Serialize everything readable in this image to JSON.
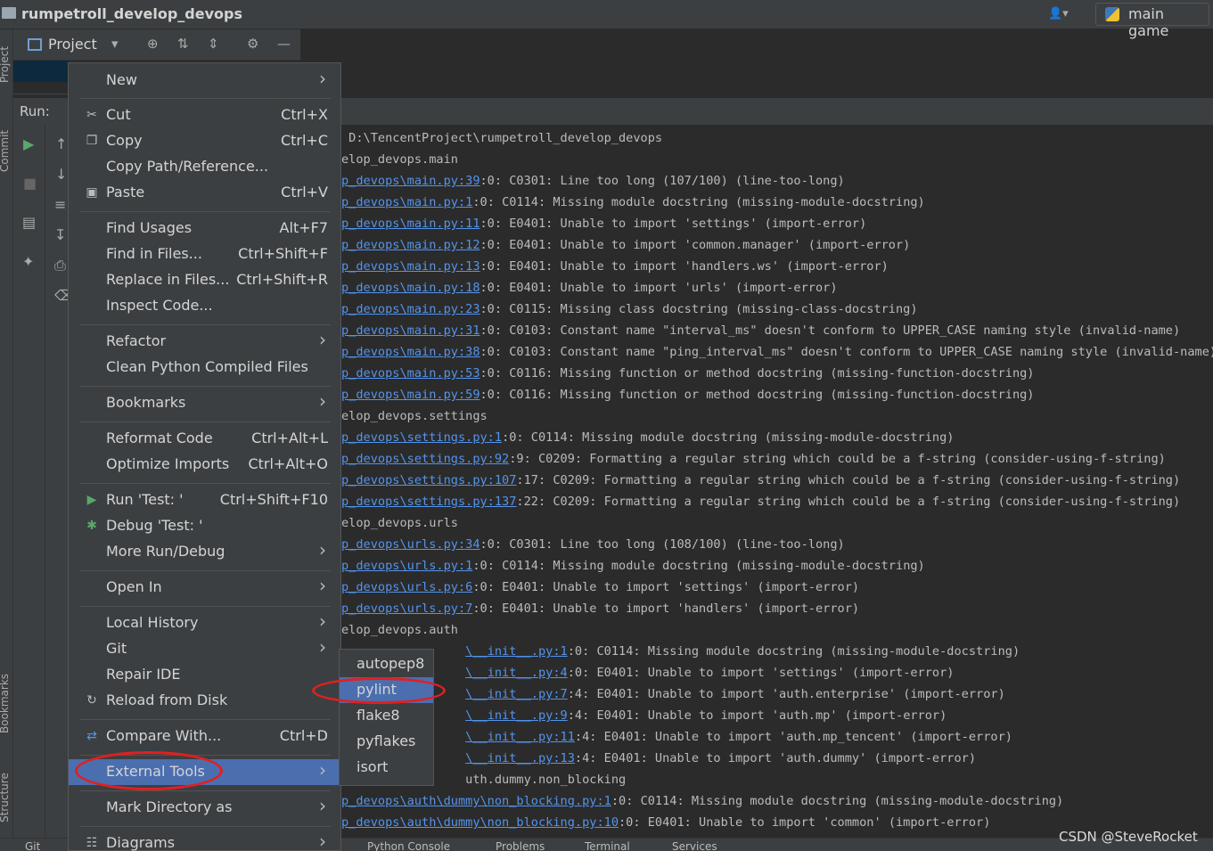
{
  "window": {
    "title": "rumpetroll_develop_devops",
    "user_icon": "user-icon",
    "config_label": "main game"
  },
  "left_stripe": {
    "tabs": [
      "Project",
      "Commit",
      "Bookmarks",
      "Structure"
    ]
  },
  "project_toolbar": {
    "label": "Project"
  },
  "run_panel": {
    "label": "Run:"
  },
  "console": {
    "lines": [
      {
        "pre": "",
        "link": "",
        "text": " D:\\TencentProject\\rumpetroll_develop_devops"
      },
      {
        "pre": "",
        "link": "",
        "text": "elop_devops.main"
      },
      {
        "pre": "",
        "link": "p_devops\\main.py:39",
        "text": ":0: C0301: Line too long (107/100) (line-too-long)"
      },
      {
        "pre": "",
        "link": "p_devops\\main.py:1",
        "text": ":0: C0114: Missing module docstring (missing-module-docstring)"
      },
      {
        "pre": "",
        "link": "p_devops\\main.py:11",
        "text": ":0: E0401: Unable to import 'settings' (import-error)"
      },
      {
        "pre": "",
        "link": "p_devops\\main.py:12",
        "text": ":0: E0401: Unable to import 'common.manager' (import-error)"
      },
      {
        "pre": "",
        "link": "p_devops\\main.py:13",
        "text": ":0: E0401: Unable to import 'handlers.ws' (import-error)"
      },
      {
        "pre": "",
        "link": "p_devops\\main.py:18",
        "text": ":0: E0401: Unable to import 'urls' (import-error)"
      },
      {
        "pre": "",
        "link": "p_devops\\main.py:23",
        "text": ":0: C0115: Missing class docstring (missing-class-docstring)"
      },
      {
        "pre": "",
        "link": "p_devops\\main.py:31",
        "text": ":0: C0103: Constant name \"interval_ms\" doesn't conform to UPPER_CASE naming style (invalid-name)"
      },
      {
        "pre": "",
        "link": "p_devops\\main.py:38",
        "text": ":0: C0103: Constant name \"ping_interval_ms\" doesn't conform to UPPER_CASE naming style (invalid-name)"
      },
      {
        "pre": "",
        "link": "p_devops\\main.py:53",
        "text": ":0: C0116: Missing function or method docstring (missing-function-docstring)"
      },
      {
        "pre": "",
        "link": "p_devops\\main.py:59",
        "text": ":0: C0116: Missing function or method docstring (missing-function-docstring)"
      },
      {
        "pre": "",
        "link": "",
        "text": "elop_devops.settings"
      },
      {
        "pre": "",
        "link": "p_devops\\settings.py:1",
        "text": ":0: C0114: Missing module docstring (missing-module-docstring)"
      },
      {
        "pre": "",
        "link": "p_devops\\settings.py:92",
        "text": ":9: C0209: Formatting a regular string which could be a f-string (consider-using-f-string)"
      },
      {
        "pre": "",
        "link": "p_devops\\settings.py:107",
        "text": ":17: C0209: Formatting a regular string which could be a f-string (consider-using-f-string)"
      },
      {
        "pre": "",
        "link": "p_devops\\settings.py:137",
        "text": ":22: C0209: Formatting a regular string which could be a f-string (consider-using-f-string)"
      },
      {
        "pre": "",
        "link": "",
        "text": "elop_devops.urls"
      },
      {
        "pre": "",
        "link": "p_devops\\urls.py:34",
        "text": ":0: C0301: Line too long (108/100) (line-too-long)"
      },
      {
        "pre": "",
        "link": "p_devops\\urls.py:1",
        "text": ":0: C0114: Missing module docstring (missing-module-docstring)"
      },
      {
        "pre": "",
        "link": "p_devops\\urls.py:6",
        "text": ":0: E0401: Unable to import 'settings' (import-error)"
      },
      {
        "pre": "",
        "link": "p_devops\\urls.py:7",
        "text": ":0: E0401: Unable to import 'handlers' (import-error)"
      },
      {
        "pre": "",
        "link": "",
        "text": "elop_devops.auth"
      },
      {
        "pre": "                 ",
        "link": "\\__init__.py:1",
        "text": ":0: C0114: Missing module docstring (missing-module-docstring)"
      },
      {
        "pre": "                 ",
        "link": "\\__init__.py:4",
        "text": ":0: E0401: Unable to import 'settings' (import-error)"
      },
      {
        "pre": "                 ",
        "link": "\\__init__.py:7",
        "text": ":4: E0401: Unable to import 'auth.enterprise' (import-error)"
      },
      {
        "pre": "                 ",
        "link": "\\__init__.py:9",
        "text": ":4: E0401: Unable to import 'auth.mp' (import-error)"
      },
      {
        "pre": "                 ",
        "link": "\\__init__.py:11",
        "text": ":4: E0401: Unable to import 'auth.mp_tencent' (import-error)"
      },
      {
        "pre": "                 ",
        "link": "\\__init__.py:13",
        "text": ":4: E0401: Unable to import 'auth.dummy' (import-error)"
      },
      {
        "pre": "",
        "link": "",
        "text": "                 uth.dummy.non_blocking"
      },
      {
        "pre": "",
        "link": "p_devops\\auth\\dummy\\non_blocking.py:1",
        "text": ":0: C0114: Missing module docstring (missing-module-docstring)"
      },
      {
        "pre": "",
        "link": "p_devops\\auth\\dummy\\non_blocking.py:10",
        "text": ":0: E0401: Unable to import 'common' (import-error)"
      }
    ]
  },
  "context_menu": {
    "items": [
      {
        "key": "new",
        "label": "New",
        "shortcut": "",
        "icon": "",
        "submenu": true
      },
      {
        "key": "cut",
        "label": "Cut",
        "shortcut": "Ctrl+X",
        "icon": "scissors-icon",
        "submenu": false
      },
      {
        "key": "copy",
        "label": "Copy",
        "shortcut": "Ctrl+C",
        "icon": "copy-icon",
        "submenu": false
      },
      {
        "key": "copy-path",
        "label": "Copy Path/Reference...",
        "shortcut": "",
        "icon": "",
        "submenu": false
      },
      {
        "key": "paste",
        "label": "Paste",
        "shortcut": "Ctrl+V",
        "icon": "clipboard-icon",
        "submenu": false
      },
      {
        "key": "find-usages",
        "label": "Find Usages",
        "shortcut": "Alt+F7",
        "icon": "",
        "submenu": false
      },
      {
        "key": "find-in-files",
        "label": "Find in Files...",
        "shortcut": "Ctrl+Shift+F",
        "icon": "",
        "submenu": false
      },
      {
        "key": "replace-in-files",
        "label": "Replace in Files...",
        "shortcut": "Ctrl+Shift+R",
        "icon": "",
        "submenu": false
      },
      {
        "key": "inspect-code",
        "label": "Inspect Code...",
        "shortcut": "",
        "icon": "",
        "submenu": false
      },
      {
        "key": "refactor",
        "label": "Refactor",
        "shortcut": "",
        "icon": "",
        "submenu": true
      },
      {
        "key": "clean-python",
        "label": "Clean Python Compiled Files",
        "shortcut": "",
        "icon": "",
        "submenu": false
      },
      {
        "key": "bookmarks",
        "label": "Bookmarks",
        "shortcut": "",
        "icon": "",
        "submenu": true
      },
      {
        "key": "reformat-code",
        "label": "Reformat Code",
        "shortcut": "Ctrl+Alt+L",
        "icon": "",
        "submenu": false
      },
      {
        "key": "optimize-imports",
        "label": "Optimize Imports",
        "shortcut": "Ctrl+Alt+O",
        "icon": "",
        "submenu": false
      },
      {
        "key": "run-test",
        "label": "Run 'Test: '",
        "shortcut": "Ctrl+Shift+F10",
        "icon": "run-icon",
        "submenu": false
      },
      {
        "key": "debug-test",
        "label": "Debug 'Test: '",
        "shortcut": "",
        "icon": "bug-icon",
        "submenu": false
      },
      {
        "key": "more-run-debug",
        "label": "More Run/Debug",
        "shortcut": "",
        "icon": "",
        "submenu": true
      },
      {
        "key": "open-in",
        "label": "Open In",
        "shortcut": "",
        "icon": "",
        "submenu": true
      },
      {
        "key": "local-history",
        "label": "Local History",
        "shortcut": "",
        "icon": "",
        "submenu": true
      },
      {
        "key": "git",
        "label": "Git",
        "shortcut": "",
        "icon": "",
        "submenu": true
      },
      {
        "key": "repair-ide",
        "label": "Repair IDE",
        "shortcut": "",
        "icon": "",
        "submenu": false
      },
      {
        "key": "reload-from-disk",
        "label": "Reload from Disk",
        "shortcut": "",
        "icon": "reload-icon",
        "submenu": false
      },
      {
        "key": "compare-with",
        "label": "Compare With...",
        "shortcut": "Ctrl+D",
        "icon": "compare-icon",
        "submenu": false
      },
      {
        "key": "external-tools",
        "label": "External Tools",
        "shortcut": "",
        "icon": "",
        "submenu": true
      },
      {
        "key": "mark-directory",
        "label": "Mark Directory as",
        "shortcut": "",
        "icon": "",
        "submenu": true
      },
      {
        "key": "diagrams",
        "label": "Diagrams",
        "shortcut": "",
        "icon": "diagram-icon",
        "submenu": true
      }
    ]
  },
  "external_tools_submenu": {
    "items": [
      "autopep8",
      "pylint",
      "flake8",
      "pyflakes",
      "isort"
    ]
  },
  "bottom_tabs": [
    "Git",
    "Python Console",
    "Problems",
    "Terminal",
    "Services"
  ],
  "watermark": "CSDN @SteveRocket",
  "colors": {
    "selection": "#4b6eaf",
    "link": "#5394ec",
    "highlight_ring": "#e02020"
  }
}
